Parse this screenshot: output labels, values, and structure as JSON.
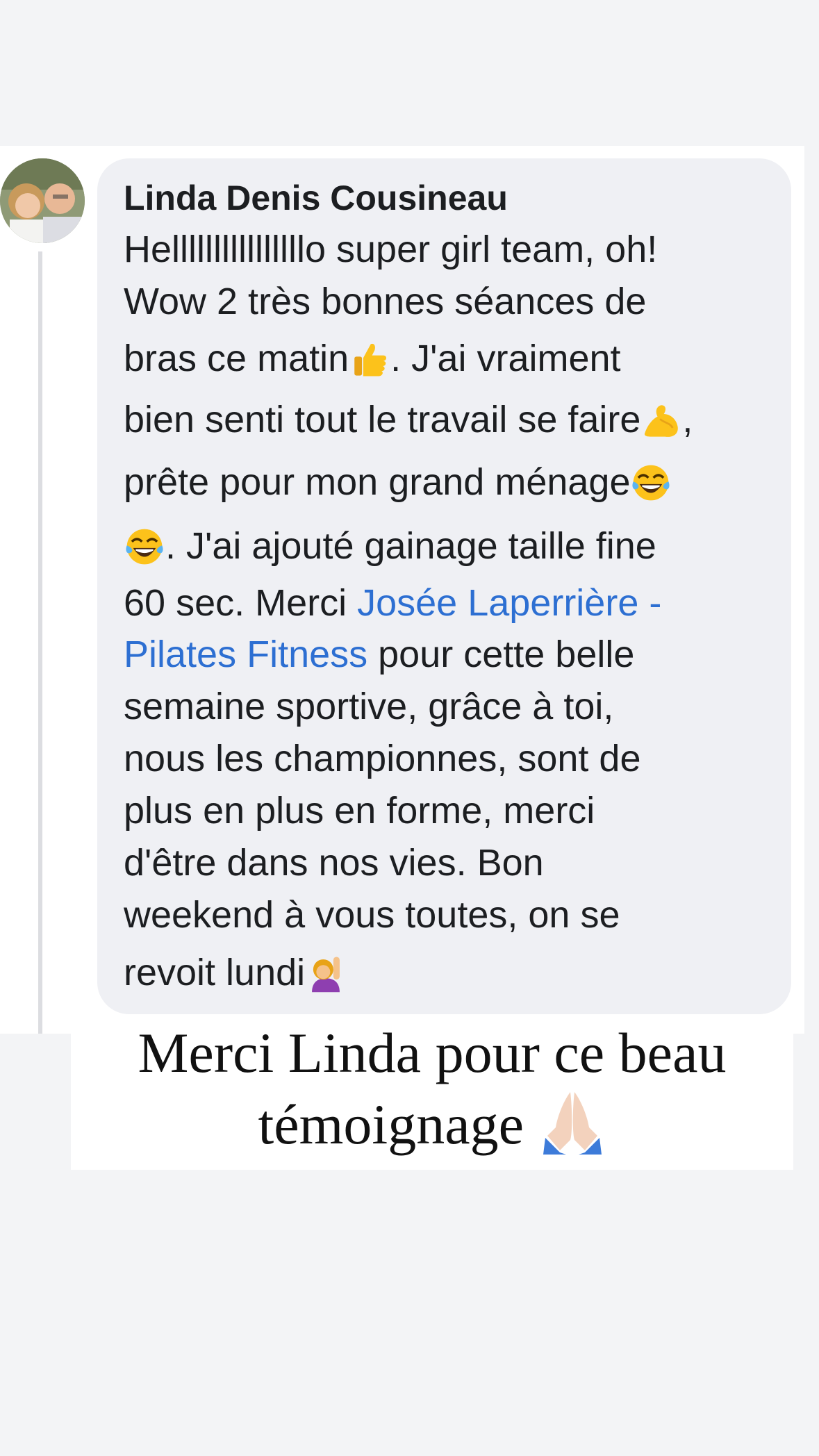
{
  "comment": {
    "author": "Linda Denis Cousineau",
    "lines": {
      "l1": "Hellllllllllllllllo super girl team, oh!",
      "l2": "Wow 2 très bonnes séances de",
      "l3a": "bras ce matin",
      "l3b": ".  J'ai vraiment",
      "l4a": "bien senti tout le travail se faire",
      "l4b": ",",
      "l5": "prête pour mon grand ménage",
      "l6": ". J'ai ajouté gainage taille fine",
      "l7a": "60 sec.  Merci ",
      "l7b": "Josée Laperrière -",
      "l8a": "Pilates Fitness",
      "l8b": " pour cette belle",
      "l9": "semaine sportive, grâce à toi,",
      "l10": "nous les championnes, sont de",
      "l11": "plus en plus en forme, merci",
      "l12": "d'être dans nos vies.  Bon",
      "l13": "weekend à vous toutes, on se",
      "l14": "revoit lundi"
    },
    "mention": "Josée Laperrière - Pilates Fitness",
    "emojis": [
      "thumbs-up",
      "flexed-biceps",
      "tears-of-joy",
      "tears-of-joy",
      "person-raising-hand"
    ]
  },
  "caption": {
    "line1": "Merci Linda pour ce beau",
    "line2": "témoignage",
    "emoji": "folded-hands"
  },
  "colors": {
    "background": "#f3f4f6",
    "bubble": "#eff0f4",
    "mention": "#2d6fd2",
    "text": "#1c1e21"
  }
}
